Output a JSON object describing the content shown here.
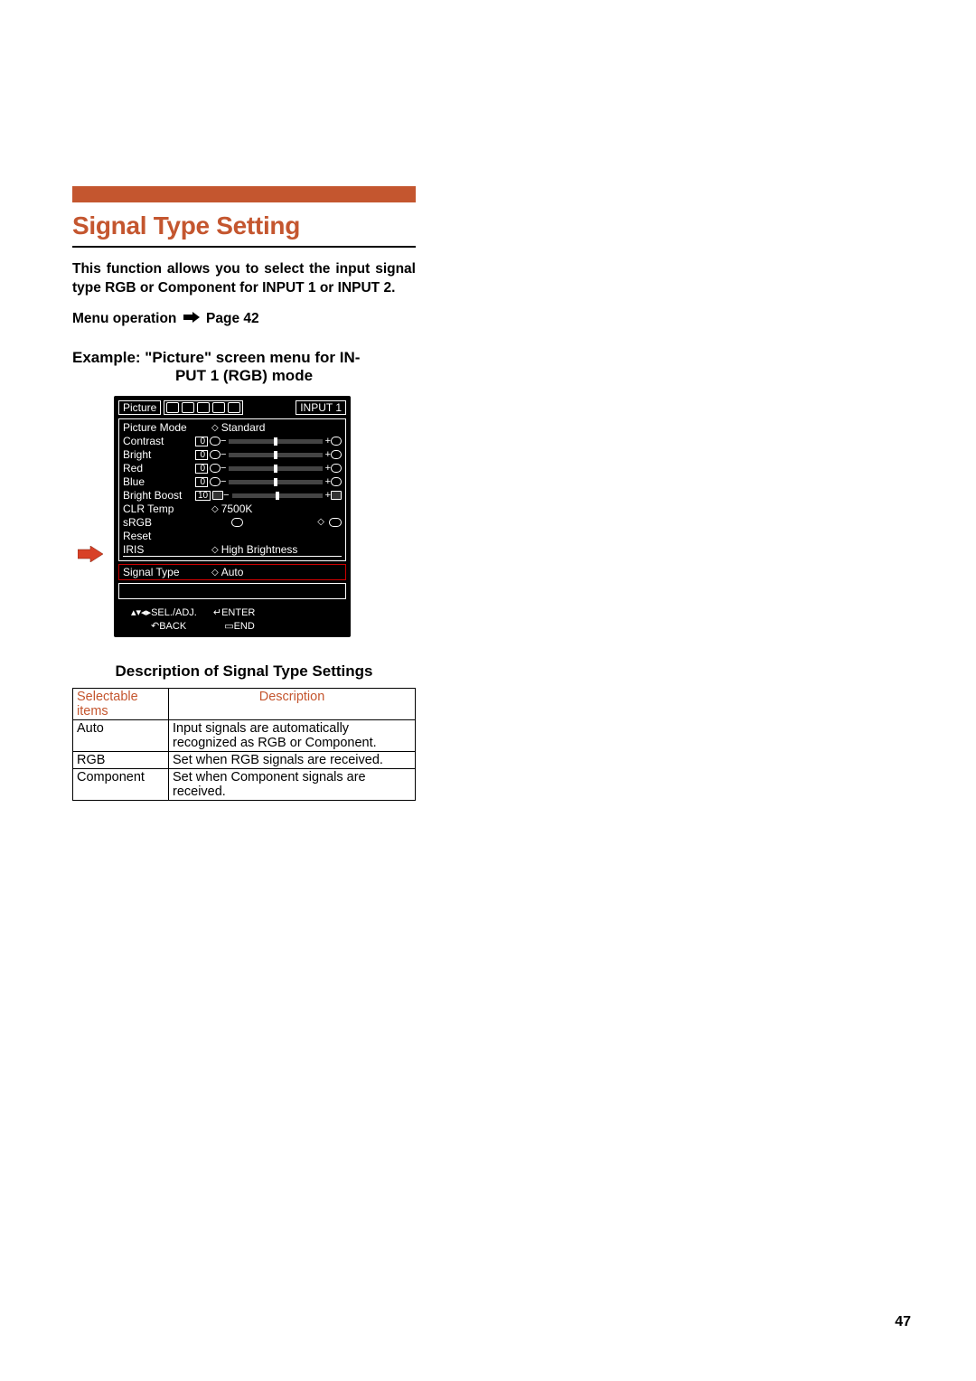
{
  "section_title": "Signal Type Setting",
  "intro_text": "This function allows you to select the input signal type RGB or Component for INPUT 1 or INPUT 2.",
  "menu_operation_prefix": "Menu operation",
  "menu_operation_page": "Page 42",
  "example_title_line1": "Example: \"Picture\" screen menu for IN-",
  "example_title_line2": "PUT 1 (RGB) mode",
  "osd": {
    "tab_active": "Picture",
    "input_label": "INPUT 1",
    "rows": {
      "picture_mode": {
        "label": "Picture Mode",
        "value": "Standard"
      },
      "contrast": {
        "label": "Contrast",
        "value": "0"
      },
      "bright": {
        "label": "Bright",
        "value": "0"
      },
      "red": {
        "label": "Red",
        "value": "0"
      },
      "blue": {
        "label": "Blue",
        "value": "0"
      },
      "bright_boost": {
        "label": "Bright Boost",
        "value": "10"
      },
      "clr_temp": {
        "label": "CLR Temp",
        "value": "7500K"
      },
      "srgb": {
        "label": "sRGB"
      },
      "reset": {
        "label": "Reset"
      },
      "iris": {
        "label": "IRIS",
        "value": "High Brightness"
      },
      "signal_type": {
        "label": "Signal Type",
        "value": "Auto"
      }
    },
    "ctrl": {
      "sel": "SEL./ADJ.",
      "enter": "ENTER",
      "back": "BACK",
      "end": "END"
    }
  },
  "desc_title": "Description of Signal Type Settings",
  "table": {
    "col1": "Selectable items",
    "col2": "Description",
    "rows": [
      {
        "item": "Auto",
        "desc": "Input signals are automatically recognized as RGB or Component."
      },
      {
        "item": "RGB",
        "desc": "Set when RGB signals are received."
      },
      {
        "item": "Component",
        "desc": "Set when Component signals are received."
      }
    ]
  },
  "page_number": "47"
}
